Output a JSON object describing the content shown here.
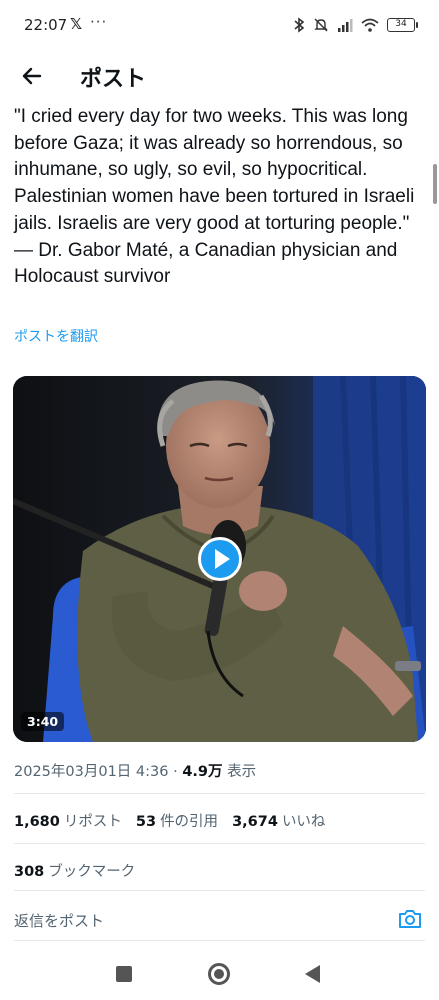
{
  "status_bar": {
    "time": "22:07",
    "x_logo": "𝕏",
    "more": "···",
    "battery": "34",
    "icons": [
      "bluetooth-icon",
      "mute-icon",
      "signal-icon",
      "wifi-icon",
      "battery-icon"
    ]
  },
  "header": {
    "title": "ポスト",
    "back_icon": "arrow-left-icon"
  },
  "tweet": {
    "text": "\"I cried every day for two weeks. This was long before Gaza; it was already so horrendous, so inhumane, so ugly, so evil, so hypocritical. Palestinian women have been tortured in Israeli jails. Israelis are very good at torturing people.\"\n— Dr. Gabor Maté, a Canadian physician and Holocaust survivor",
    "translate_label": "ポストを翻訳"
  },
  "video": {
    "duration": "3:40",
    "play_icon": "play-icon"
  },
  "meta": {
    "timestamp": "2025年03月01日 4:36",
    "separator": " · ",
    "views_count": "4.9万",
    "views_label": " 表示"
  },
  "stats": {
    "reposts_count": "1,680",
    "reposts_label": "リポスト",
    "quotes_count": "53",
    "quotes_label": "件の引用",
    "likes_count": "3,674",
    "likes_label": "いいね"
  },
  "bookmarks": {
    "count": "308",
    "label": "ブックマーク"
  },
  "reply": {
    "placeholder": "返信をポスト",
    "camera_icon": "camera-icon"
  },
  "colors": {
    "accent": "#1d9bf0",
    "text": "#0f1419",
    "secondary": "#536471"
  }
}
